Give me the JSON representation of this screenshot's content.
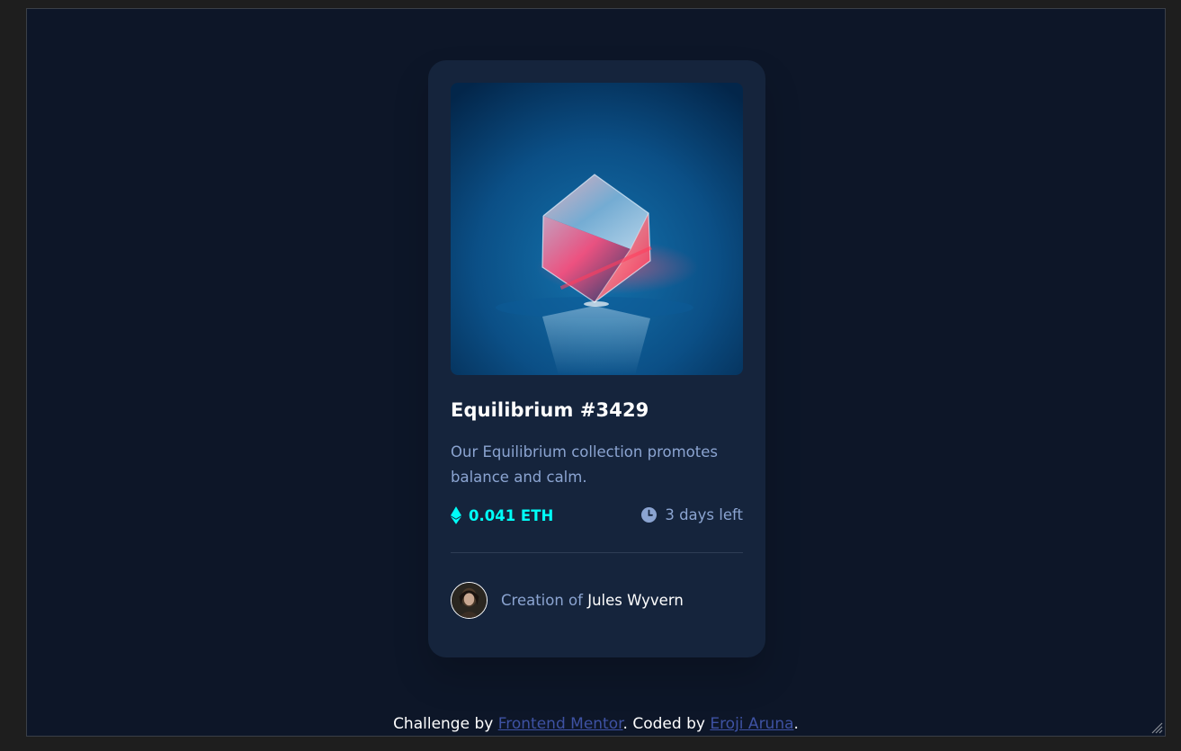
{
  "card": {
    "title": "Equilibrium #3429",
    "description": "Our Equilibrium collection promotes balance and calm.",
    "price": "0.041 ETH",
    "time_left": "3 days left",
    "creator_prefix": "Creation of",
    "creator_name": "Jules Wyvern",
    "image_alt": "Equilibrium cube"
  },
  "footer": {
    "challenge_prefix": "Challenge by",
    "challenge_link": "Frontend Mentor",
    "coded_prefix": ". Coded by",
    "coded_link": "Eroji Aruna",
    "suffix": "."
  },
  "colors": {
    "page_bg": "#0d1628",
    "card_bg": "#15243c",
    "accent_cyan": "#00fff8",
    "soft_blue": "#8ba4d1",
    "link_blue": "#3e52a3"
  },
  "icons": {
    "eth": "ethereum-icon",
    "clock": "clock-icon"
  }
}
